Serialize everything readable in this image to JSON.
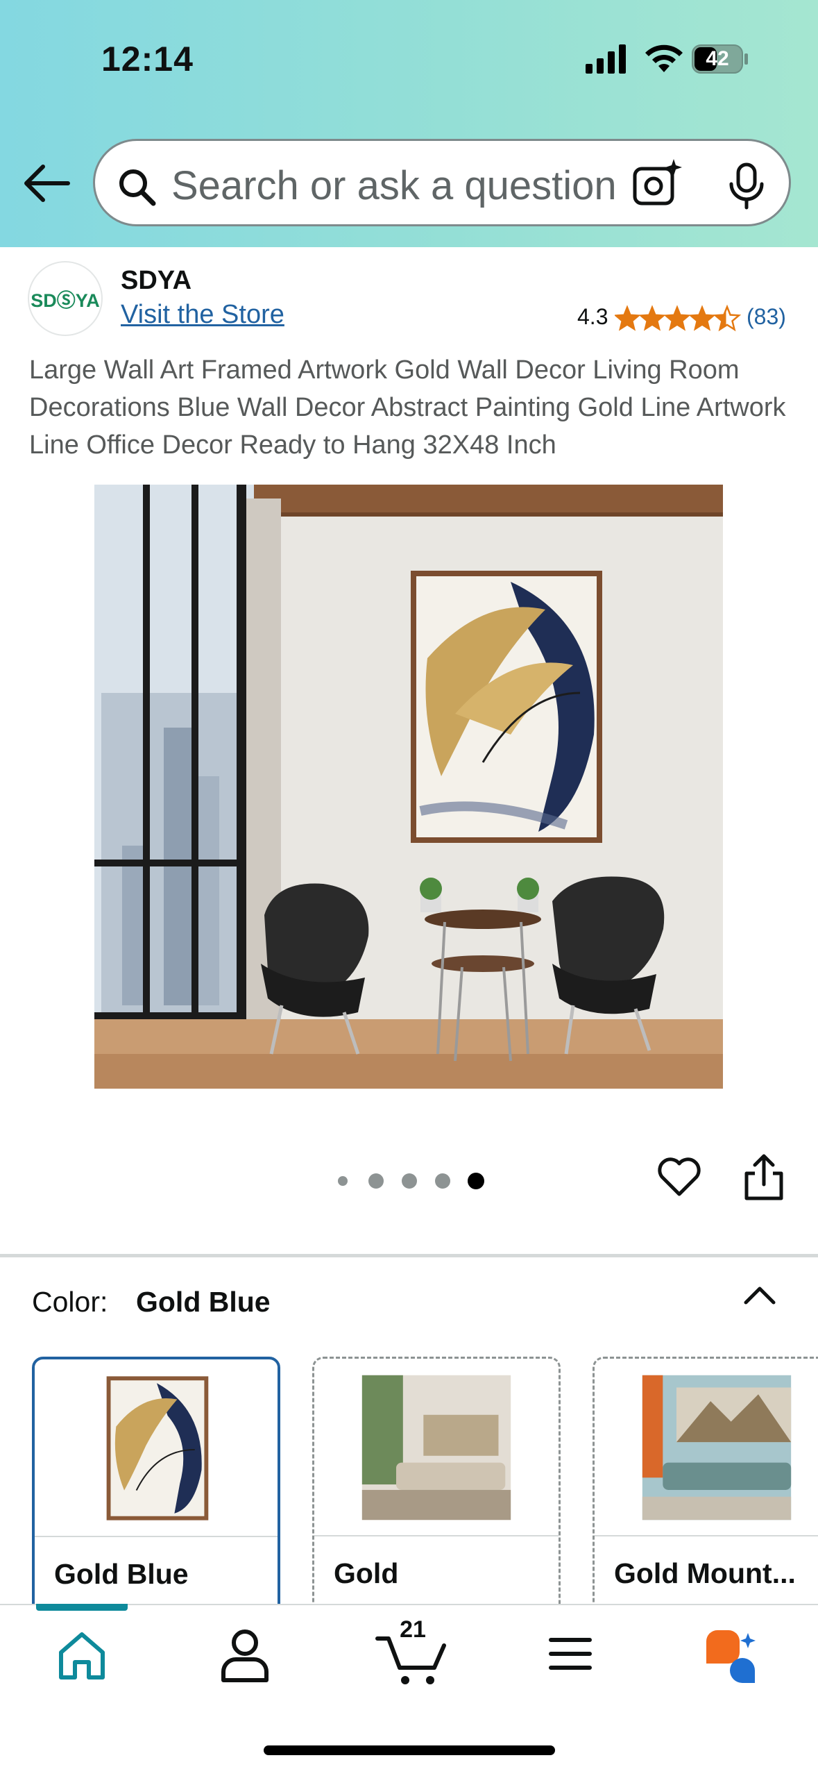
{
  "status_bar": {
    "time": "12:14",
    "battery": "42"
  },
  "search": {
    "placeholder": "Search or ask a question"
  },
  "brand": {
    "logo_text": "SDⓈYA",
    "name": "SDYA",
    "visit_store": "Visit the Store"
  },
  "rating": {
    "value": "4.3",
    "stars": 4.3,
    "count": "(83)"
  },
  "product": {
    "title": "Large Wall Art Framed Artwork Gold Wall Decor Living Room Decorations Blue Wall Decor Abstract Painting Gold Line Artwork Line Office Decor Ready to Hang 32X48 Inch",
    "image_count": 5,
    "active_image_index": 4
  },
  "color": {
    "label": "Color:",
    "selected": "Gold Blue",
    "options": [
      {
        "label": "Gold Blue",
        "selected": true
      },
      {
        "label": "Gold",
        "selected": false
      },
      {
        "label": "Gold Mount...",
        "selected": false
      }
    ]
  },
  "bottom_nav": {
    "items": [
      "home-icon",
      "account-icon",
      "cart-icon",
      "menu-icon",
      "rufus-icon"
    ],
    "cart_count": "21",
    "active": "home"
  },
  "colors": {
    "header_gradient_start": "#84d8e1",
    "header_gradient_end": "#a5e6d1",
    "link": "#2162a1",
    "star": "#e47911",
    "nav_active": "#0e8a9b"
  }
}
